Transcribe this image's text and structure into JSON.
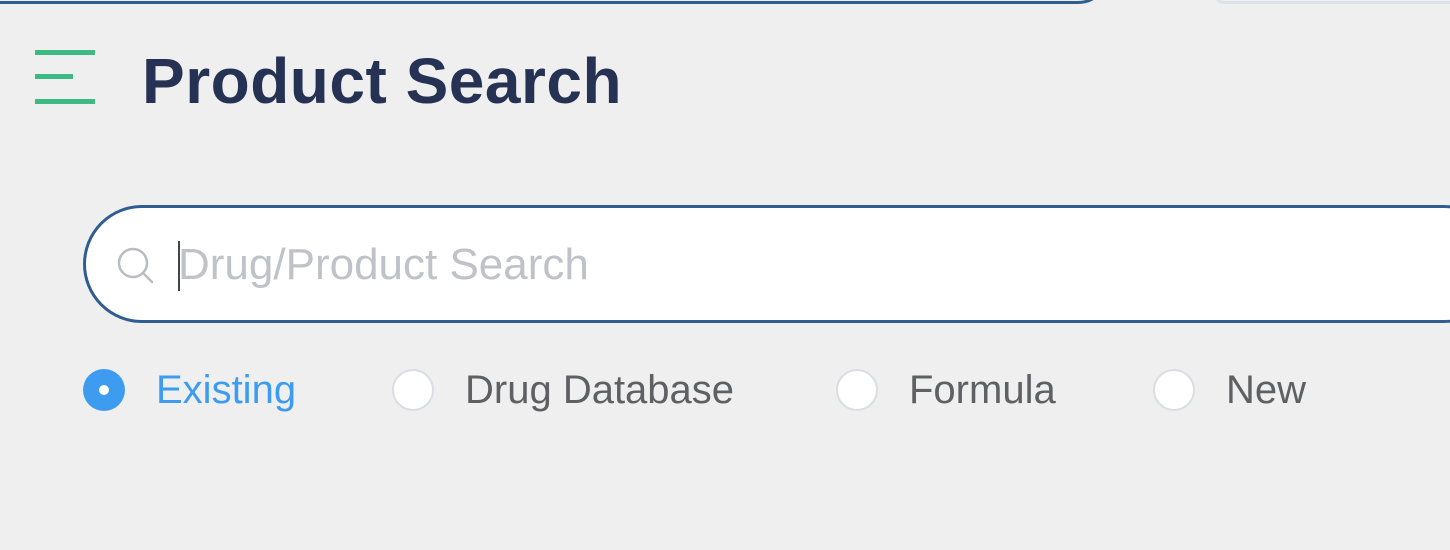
{
  "header": {
    "title": "Product Search",
    "menu_icon": "hamburger-menu-icon"
  },
  "search": {
    "placeholder": "Drug/Product Search",
    "value": "",
    "icon": "search-icon"
  },
  "search_type": {
    "selected": "Existing",
    "options": [
      {
        "label": "Existing",
        "checked": true
      },
      {
        "label": "Drug Database",
        "checked": false
      },
      {
        "label": "Formula",
        "checked": false
      },
      {
        "label": "New",
        "checked": false
      }
    ]
  },
  "colors": {
    "accent_green": "#3dba84",
    "title_navy": "#263253",
    "border_blue": "#2f5d8f",
    "selected_blue": "#3d9cf0",
    "background": "#efefef"
  }
}
